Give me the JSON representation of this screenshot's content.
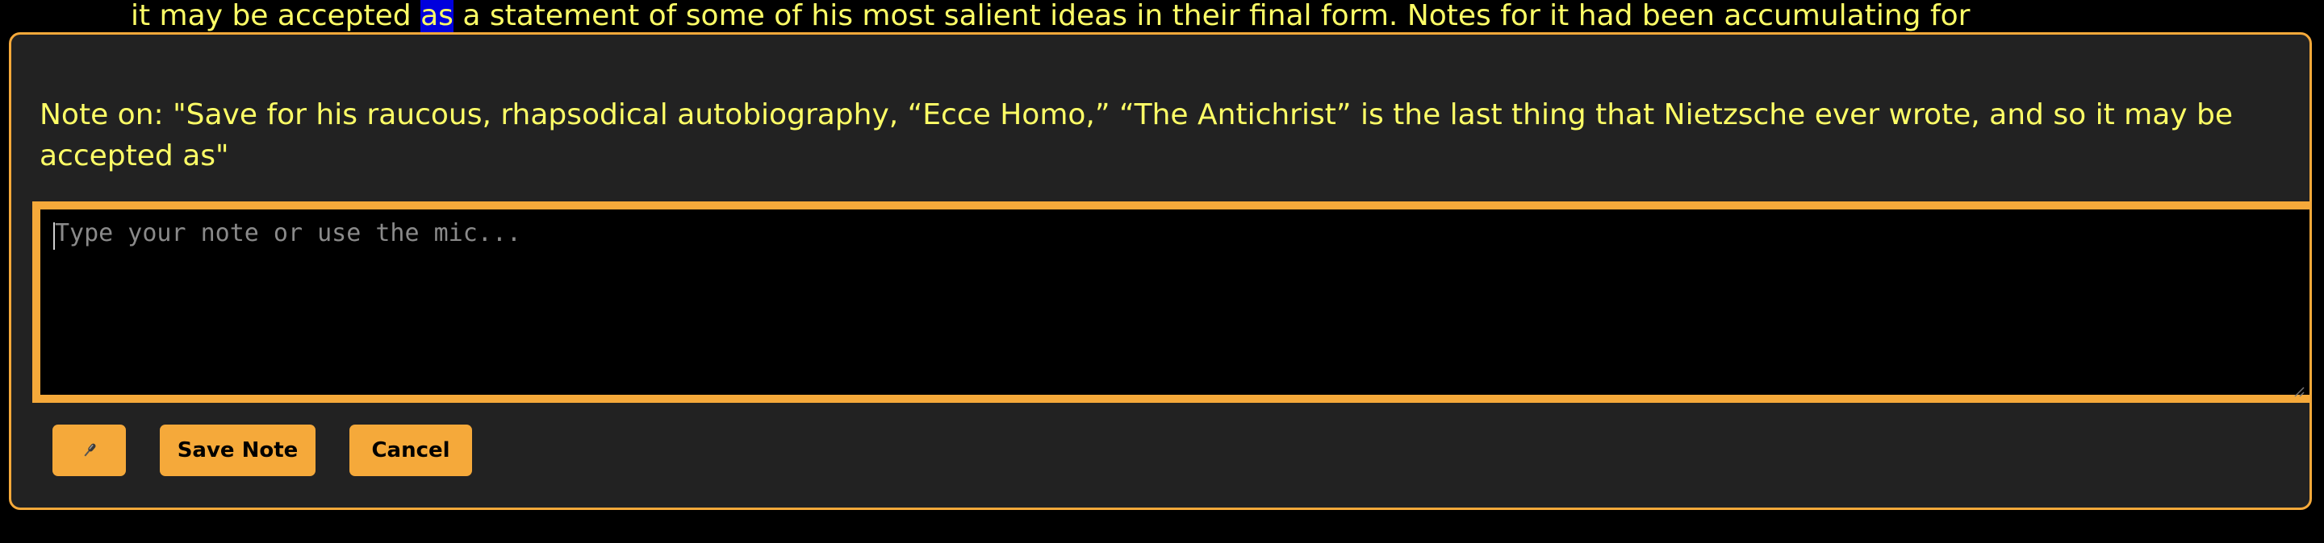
{
  "reader": {
    "before_highlight": "it may be accepted ",
    "highlight": "as",
    "after_highlight": " a statement of some of his most salient ideas in their final form. Notes for it had been accumulating for"
  },
  "note_dialog": {
    "heading": "Note on: \"Save for his raucous, rhapsodical autobiography, “Ecce Homo,” “The Antichrist” is the last thing that Nietzsche ever wrote, and so it may be accepted as\"",
    "input_value": "",
    "input_placeholder": "Type your note or use the mic...",
    "mic_icon": "microphone-icon",
    "save_label": "Save Note",
    "cancel_label": "Cancel"
  },
  "colors": {
    "accent": "#f5a93a",
    "text_yellow": "#ffff66",
    "panel_bg": "#222222",
    "page_bg": "#000000",
    "highlight_bg": "#0000dd"
  }
}
